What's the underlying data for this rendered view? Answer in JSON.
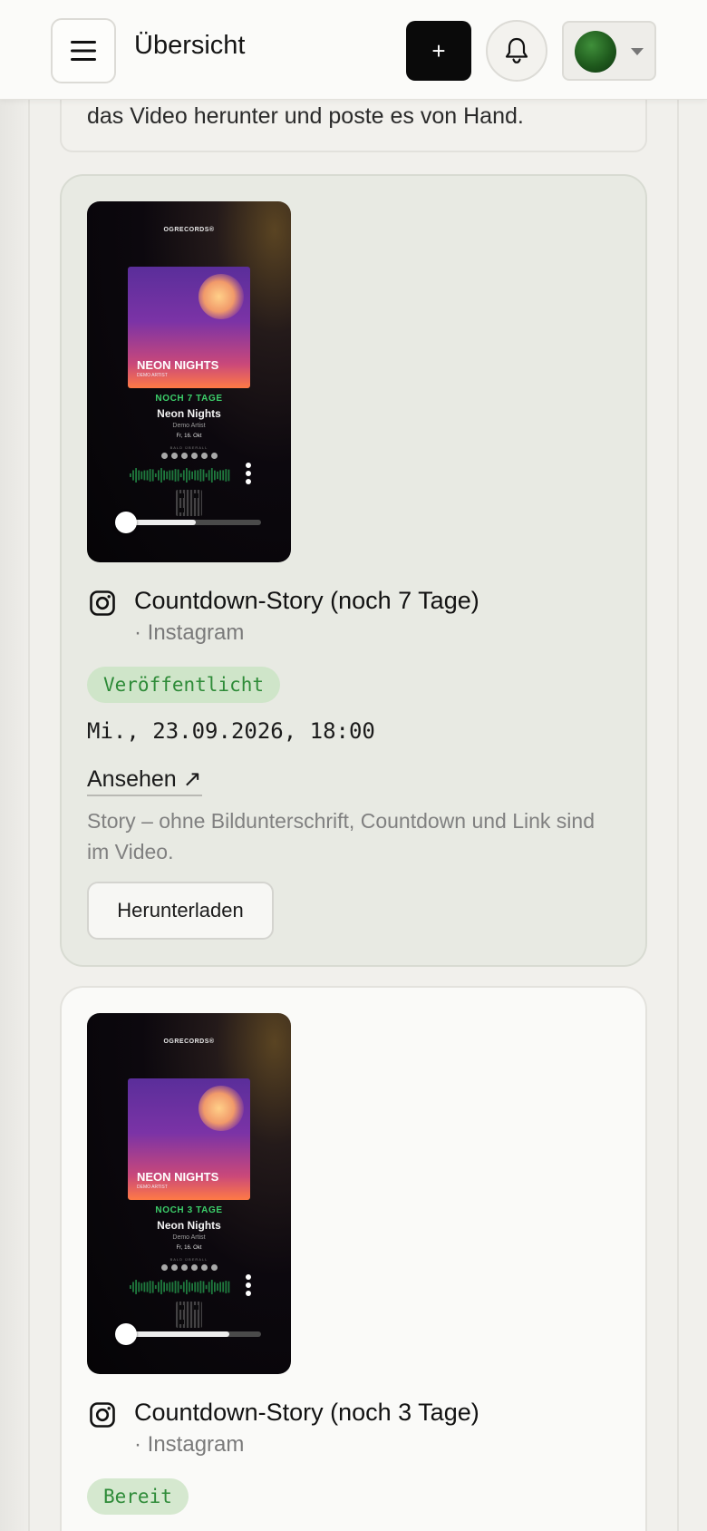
{
  "header": {
    "title": "Übersicht",
    "add_label": "+"
  },
  "notice": {
    "text": "das Video herunter und poste es von Hand."
  },
  "posts": [
    {
      "thumbnail": {
        "brand": "OGRECORDS®",
        "cover_title": "NEON NIGHTS",
        "cover_artist": "DEMO ARTIST",
        "countdown": "NOCH 7 TAGE",
        "song": "Neon Nights",
        "artist": "Demo Artist",
        "release_date": "Fr, 16. Okt",
        "soon_label": "BALD ÜBERALL",
        "playback_progress": 0.55
      },
      "title": "Countdown-Story (noch 7 Tage)",
      "platform": "· Instagram",
      "status": "Veröffentlicht",
      "date": "Mi., 23.09.2026, 18:00",
      "view_label": "Ansehen ↗",
      "note": "Story – ohne Bildunterschrift, Countdown und Link sind im Video.",
      "download_label": "Herunterladen"
    },
    {
      "thumbnail": {
        "brand": "OGRECORDS®",
        "cover_title": "NEON NIGHTS",
        "cover_artist": "DEMO ARTIST",
        "countdown": "NOCH 3 TAGE",
        "song": "Neon Nights",
        "artist": "Demo Artist",
        "release_date": "Fr, 16. Okt",
        "soon_label": "BALD ÜBERALL",
        "playback_progress": 0.78
      },
      "title": "Countdown-Story (noch 3 Tage)",
      "platform": "· Instagram",
      "status": "Bereit"
    }
  ],
  "colors": {
    "status_green": "#2e8b38",
    "badge_bg": "#cfe5c9",
    "countdown_green": "#3ccf6a"
  }
}
